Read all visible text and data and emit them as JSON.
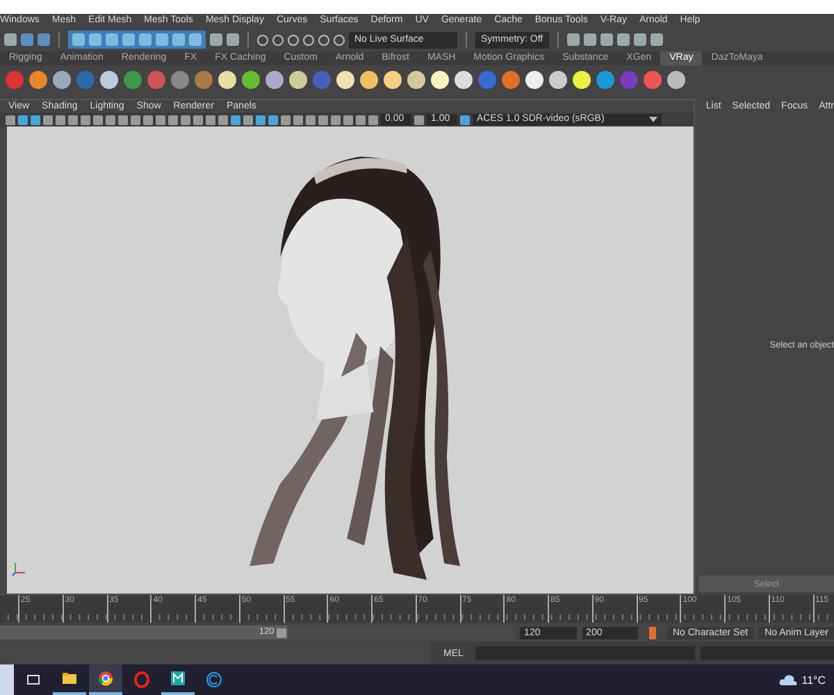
{
  "menu_bar": {
    "items": [
      "Windows",
      "Mesh",
      "Edit Mesh",
      "Mesh Tools",
      "Mesh Display",
      "Curves",
      "Surfaces",
      "Deform",
      "UV",
      "Generate",
      "Cache",
      "Bonus Tools",
      "V-Ray",
      "Arnold",
      "Help"
    ]
  },
  "status_line": {
    "live_surface": "No Live Surface",
    "symmetry": "Symmetry: Off"
  },
  "shelf_tabs": [
    {
      "label": "Rigging",
      "selected": false
    },
    {
      "label": "Animation",
      "selected": false
    },
    {
      "label": "Rendering",
      "selected": false
    },
    {
      "label": "FX",
      "selected": false
    },
    {
      "label": "FX Caching",
      "selected": false
    },
    {
      "label": "Custom",
      "selected": false
    },
    {
      "label": "Arnold",
      "selected": false
    },
    {
      "label": "Bifrost",
      "selected": false
    },
    {
      "label": "MASH",
      "selected": false
    },
    {
      "label": "Motion Graphics",
      "selected": false
    },
    {
      "label": "Substance",
      "selected": false
    },
    {
      "label": "XGen",
      "selected": false
    },
    {
      "label": "VRay",
      "selected": true
    },
    {
      "label": "DazToMaya",
      "selected": false
    }
  ],
  "viewport": {
    "menu": [
      "View",
      "Shading",
      "Lighting",
      "Show",
      "Renderer",
      "Panels"
    ],
    "exposure": "0.00",
    "gamma": "1.00",
    "color_space": "ACES 1.0 SDR-video (sRGB)"
  },
  "attribute_editor": {
    "menu": [
      "List",
      "Selected",
      "Focus",
      "Attr"
    ],
    "message": "Select an object",
    "button": "Select"
  },
  "time_slider": {
    "labels": [
      "25",
      "30",
      "35",
      "40",
      "45",
      "50",
      "55",
      "60",
      "65",
      "70",
      "75",
      "80",
      "85",
      "90",
      "95",
      "100",
      "105",
      "110",
      "115"
    ]
  },
  "range_slider": {
    "level": 0.56,
    "range_end": "120",
    "end_time": "120",
    "max_time": "200",
    "character_set": "No Character Set",
    "anim_layer": "No Anim Layer"
  },
  "command_line": {
    "language": "MEL"
  },
  "taskbar": {
    "apps": [
      {
        "kind": "task-view",
        "running": false,
        "selected": false
      },
      {
        "kind": "folder",
        "running": true,
        "selected": false
      },
      {
        "kind": "chrome",
        "running": true,
        "selected": true
      },
      {
        "kind": "opera",
        "running": false,
        "selected": false
      },
      {
        "kind": "maya",
        "running": true,
        "selected": false
      },
      {
        "kind": "ccleaner",
        "running": false,
        "selected": false
      }
    ],
    "temperature": "11°C"
  }
}
